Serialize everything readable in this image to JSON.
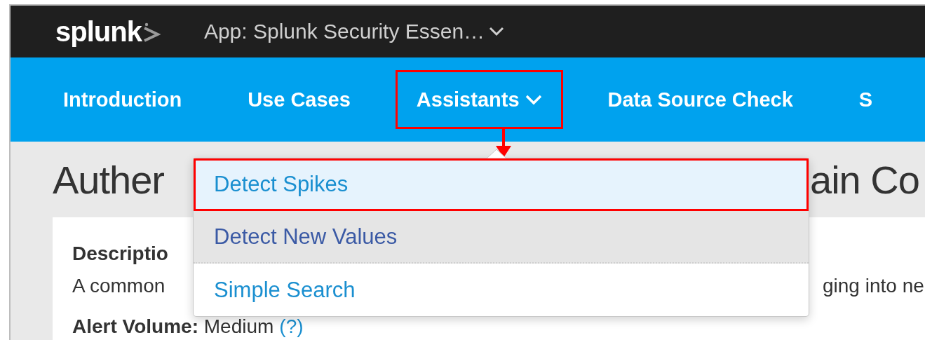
{
  "top_bar": {
    "logo": "splunk",
    "app_label": "App: Splunk Security Essen…"
  },
  "nav": [
    {
      "label": "Introduction",
      "kind": "link",
      "annotated": false
    },
    {
      "label": "Use Cases",
      "kind": "link",
      "annotated": false
    },
    {
      "label": "Assistants",
      "kind": "dropdown",
      "annotated": true
    },
    {
      "label": "Data Source Check",
      "kind": "link",
      "annotated": false
    },
    {
      "label": "S",
      "kind": "link",
      "annotated": false
    }
  ],
  "dropdown": {
    "items": [
      {
        "label": "Detect Spikes",
        "selected": true,
        "hovered": false,
        "annotated": true
      },
      {
        "label": "Detect New Values",
        "selected": false,
        "hovered": true,
        "annotated": false
      },
      {
        "label": "Simple Search",
        "selected": false,
        "hovered": false,
        "annotated": false
      }
    ]
  },
  "page": {
    "title_left": "Auther",
    "title_right": "ain Co",
    "description_label": "Descriptio",
    "description_left": "A common",
    "description_right": "ging into ne",
    "alert_volume": "**Alert Volume:** Medium",
    "alert_help": "(?)"
  }
}
